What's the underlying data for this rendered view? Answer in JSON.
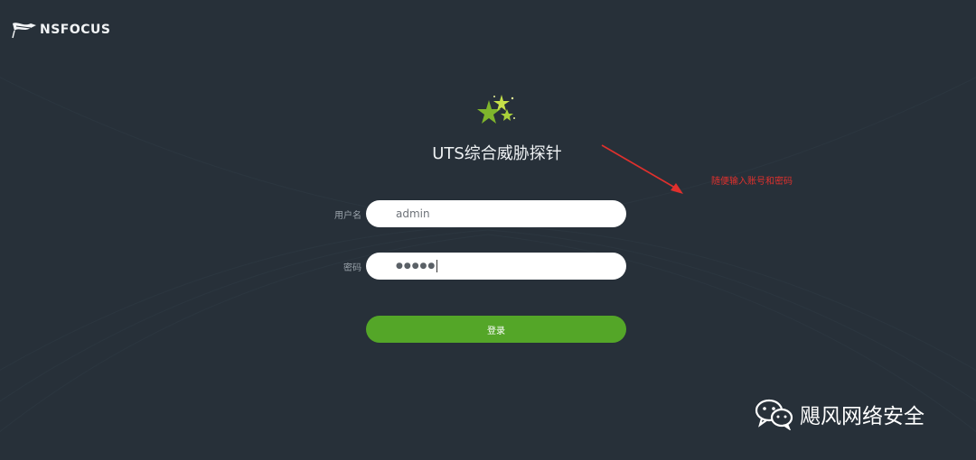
{
  "brand": {
    "logo_text": "NSFOCUS"
  },
  "app": {
    "title": "UTS综合威胁探针"
  },
  "form": {
    "username_label": "用户名",
    "username_value": "admin",
    "password_label": "密码",
    "password_masked": "●●●●●",
    "login_label": "登录"
  },
  "annotation": {
    "text": "随便输入账号和密码"
  },
  "watermark": {
    "text": "飓风网络安全"
  },
  "colors": {
    "background": "#273039",
    "login_button": "#54a628",
    "annotation": "#e0302d"
  }
}
